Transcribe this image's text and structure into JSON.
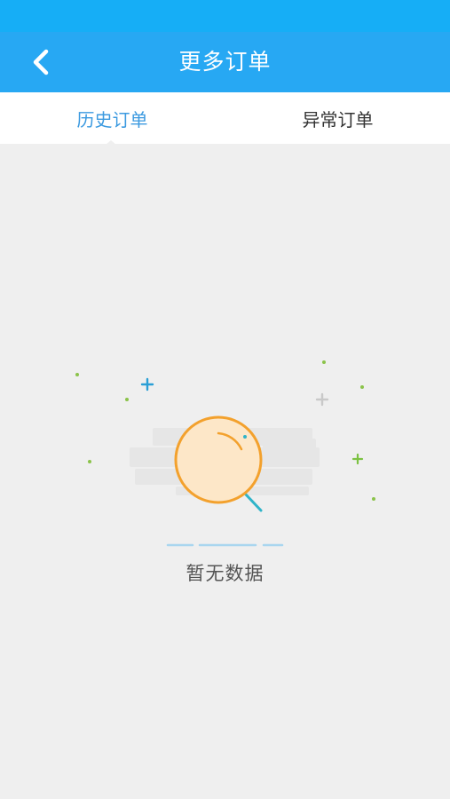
{
  "header": {
    "title": "更多订单",
    "back_icon": "chevron-left-icon"
  },
  "tabs": [
    {
      "label": "历史订单",
      "active": true
    },
    {
      "label": "异常订单",
      "active": false
    }
  ],
  "empty_state": {
    "message": "暂无数据",
    "icon": "magnifier-icon"
  },
  "colors": {
    "status_bar": "#16aef6",
    "header": "#27a8f3",
    "active_tab": "#3c9ae0",
    "page_background": "#efefef"
  }
}
